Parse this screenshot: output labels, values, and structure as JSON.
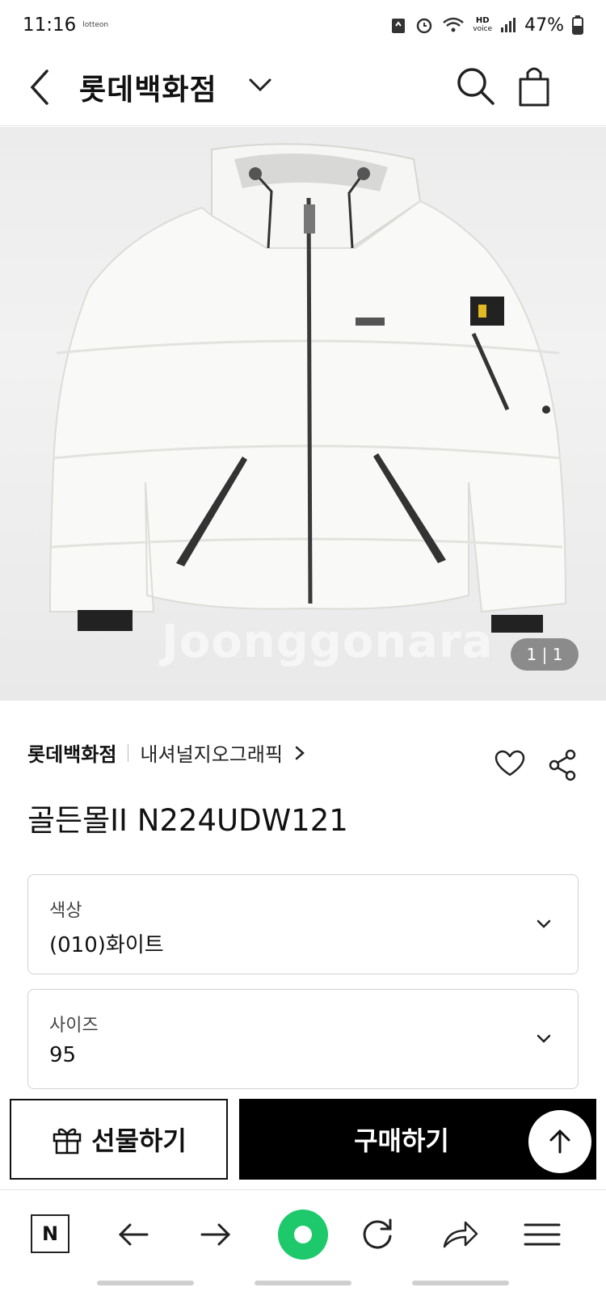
{
  "status_bar": {
    "time": "11:16",
    "tiny_label": "lotteon",
    "hd_top": "HD",
    "hd_bottom": "voice",
    "battery": "47%"
  },
  "header": {
    "store_title": "롯데백화점"
  },
  "hero": {
    "watermark": "Joonggonara",
    "counter": "1 | 1"
  },
  "product": {
    "brand": "롯데백화점",
    "sub_brand": "내셔널지오그래픽",
    "name": "골든몰II N224UDW121"
  },
  "options": [
    {
      "label": "색상",
      "value": "(010)화이트"
    },
    {
      "label": "사이즈",
      "value": "95"
    }
  ],
  "actions": {
    "gift_label": "선물하기",
    "buy_label": "구매하기"
  },
  "browser": {
    "home_label": "N"
  },
  "colors": {
    "buy_button": "#000000",
    "browser_accent": "#1ec96b"
  }
}
